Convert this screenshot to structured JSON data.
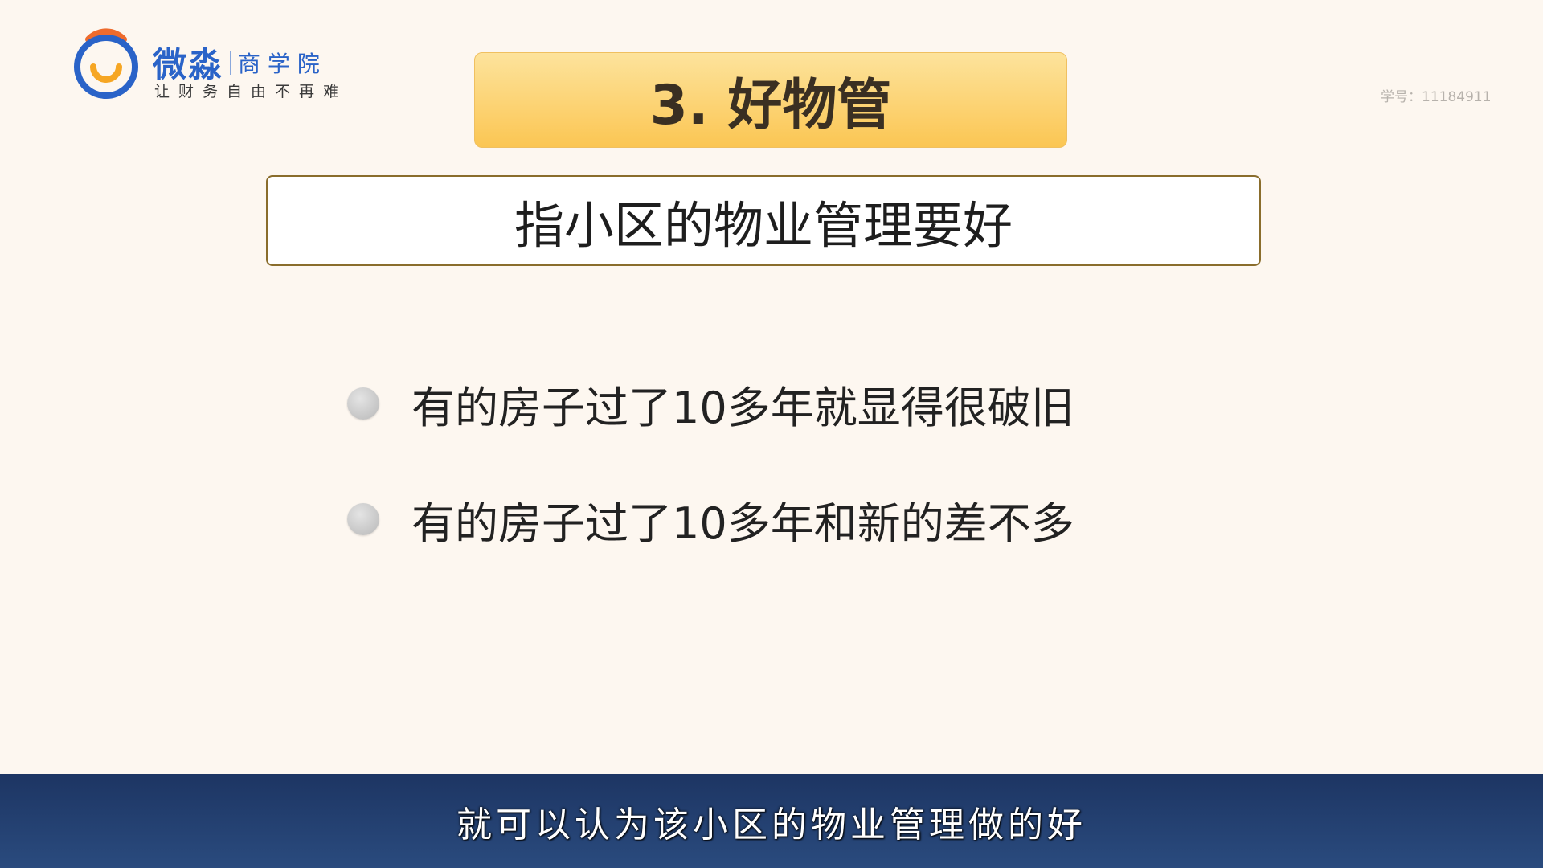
{
  "logo": {
    "brand": "微淼",
    "sub": "商 学 院",
    "slogan": "让财务自由不再难",
    "colors": {
      "ring": "#2a63c8",
      "arc": "#ee6b2d",
      "smile": "#f6a623"
    }
  },
  "student_number": "学号：11184911",
  "title": "3. 好物管",
  "definition": "指小区的物业管理要好",
  "bullets": [
    "有的房子过了10多年就显得很破旧",
    "有的房子过了10多年和新的差不多"
  ],
  "subtitle": "就可以认为该小区的物业管理做的好"
}
